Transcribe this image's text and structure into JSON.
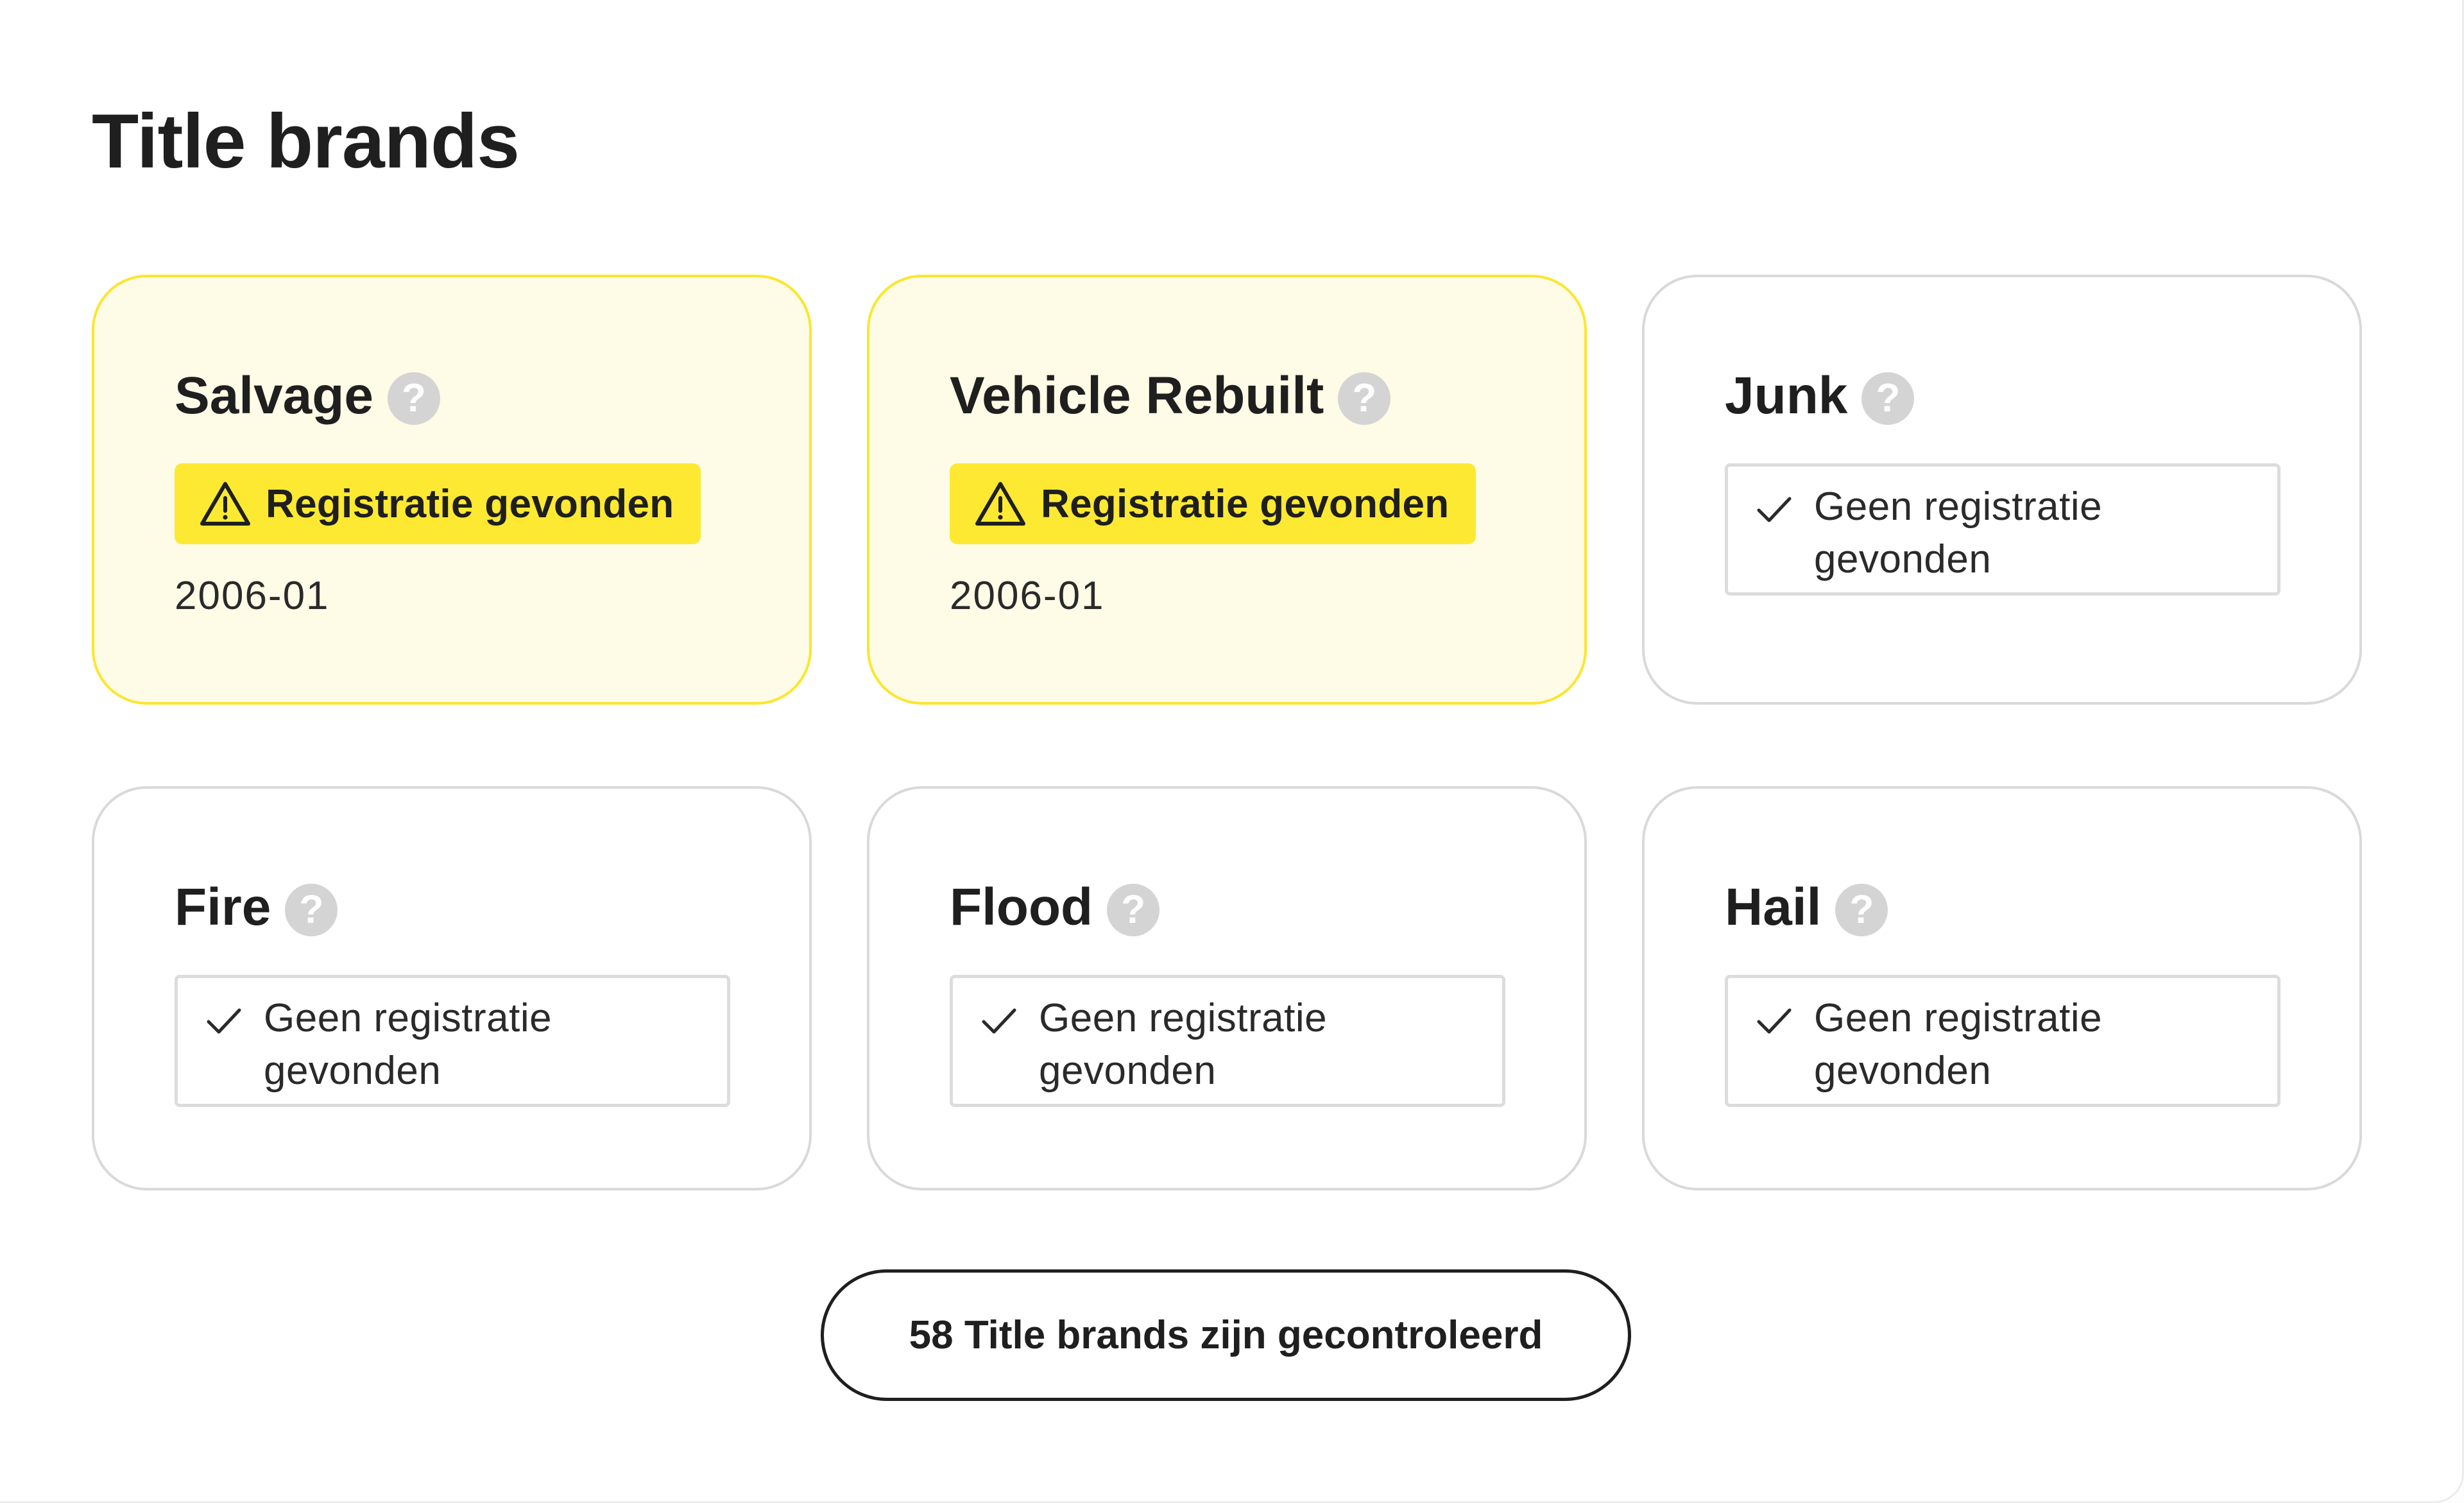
{
  "page": {
    "title": "Title brands"
  },
  "cards": [
    {
      "title": "Salvage",
      "status": "found",
      "badge_label": "Registratie gevonden",
      "date": "2006-01"
    },
    {
      "title": "Vehicle Rebuilt",
      "status": "found",
      "badge_label": "Registratie gevonden",
      "date": "2006-01"
    },
    {
      "title": "Junk",
      "status": "not_found",
      "badge_label": "Geen registratie gevonden"
    },
    {
      "title": "Fire",
      "status": "not_found",
      "badge_label": "Geen registratie gevonden"
    },
    {
      "title": "Flood",
      "status": "not_found",
      "badge_label": "Geen registratie gevonden"
    },
    {
      "title": "Hail",
      "status": "not_found",
      "badge_label": "Geen registratie gevonden"
    }
  ],
  "help_icon_glyph": "?",
  "icons": {
    "help": "help-circle-icon",
    "warning": "warning-triangle-icon",
    "check": "checkmark-icon"
  },
  "summary": {
    "button_label": "58 Title brands zijn gecontroleerd"
  },
  "colors": {
    "warn_badge_bg": "#fde932",
    "warn_card_bg": "#fefbe6",
    "warn_card_border": "#fbe62f",
    "neutral_border": "#d9d9d9",
    "text": "#1f1f1f"
  }
}
